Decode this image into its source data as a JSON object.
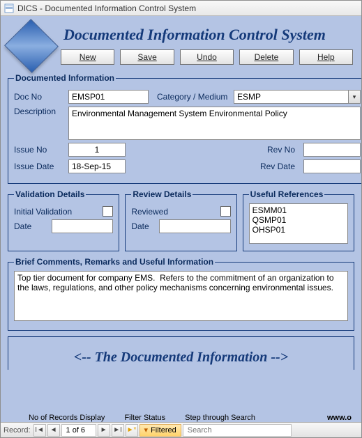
{
  "window": {
    "title": "DICS - Documented Information Control System"
  },
  "header": {
    "heading": "Documented Information Control System"
  },
  "toolbar": {
    "new": "New",
    "save": "Save",
    "undo": "Undo",
    "delete": "Delete",
    "help": "Help"
  },
  "docinfo": {
    "legend": "Documented Information",
    "docno_label": "Doc No",
    "docno_value": "EMSP01",
    "category_label": "Category / Medium",
    "category_value": "ESMP",
    "description_label": "Description",
    "description_value": "Environmental Management System Environmental Policy",
    "issueno_label": "Issue No",
    "issueno_value": "1",
    "revno_label": "Rev No",
    "revno_value": "",
    "issuedate_label": "Issue Date",
    "issuedate_value": "18-Sep-15",
    "revdate_label": "Rev Date",
    "revdate_value": ""
  },
  "validation": {
    "legend": "Validation Details",
    "initial_label": "Initial Validation",
    "date_label": "Date",
    "date_value": ""
  },
  "review": {
    "legend": "Review Details",
    "reviewed_label": "Reviewed",
    "date_label": "Date",
    "date_value": ""
  },
  "references": {
    "legend": "Useful References",
    "items": [
      "ESMM01",
      "QSMP01",
      "OHSP01"
    ]
  },
  "comments": {
    "legend": "Brief Comments, Remarks and Useful Information",
    "text": "Top tier document for company EMS.  Refers to the commitment of an organization to the laws, regulations, and other policy mechanisms concerning environmental issues."
  },
  "footer_heading": "<-- The Documented Information -->",
  "status": {
    "records_label": "No of Records Display",
    "filter_label": "Filter Status",
    "search_label": "Step through Search",
    "url": "www.o"
  },
  "nav": {
    "label": "Record:",
    "position": "1 of 6",
    "filtered": "Filtered",
    "search_placeholder": "Search"
  }
}
